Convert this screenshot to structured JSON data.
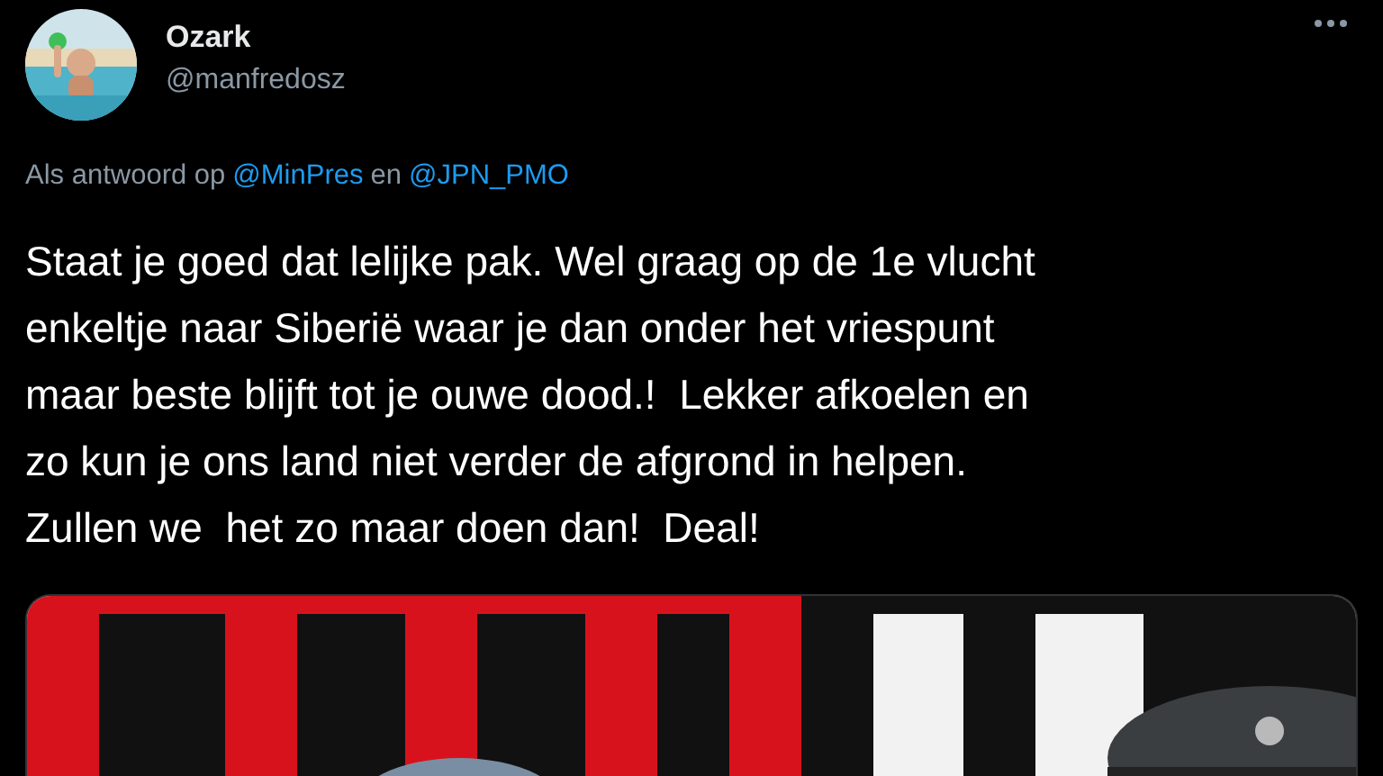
{
  "author": {
    "name": "Ozark",
    "handle": "@manfredosz"
  },
  "reply_to": {
    "prefix": "Als antwoord op",
    "mentions": [
      "@MinPres",
      "@JPN_PMO"
    ],
    "joiner": "en"
  },
  "text": "Staat je goed dat lelijke pak. Wel graag op de 1e vlucht\nenkeltje naar Siberië waar je dan onder het vriespunt\nmaar beste blijft tot je ouwe dood.!  Lekker afkoelen en\nzo kun je ons land niet verder de afgrond in helpen.\nZullen we  het zo maar doen dan!  Deal!"
}
